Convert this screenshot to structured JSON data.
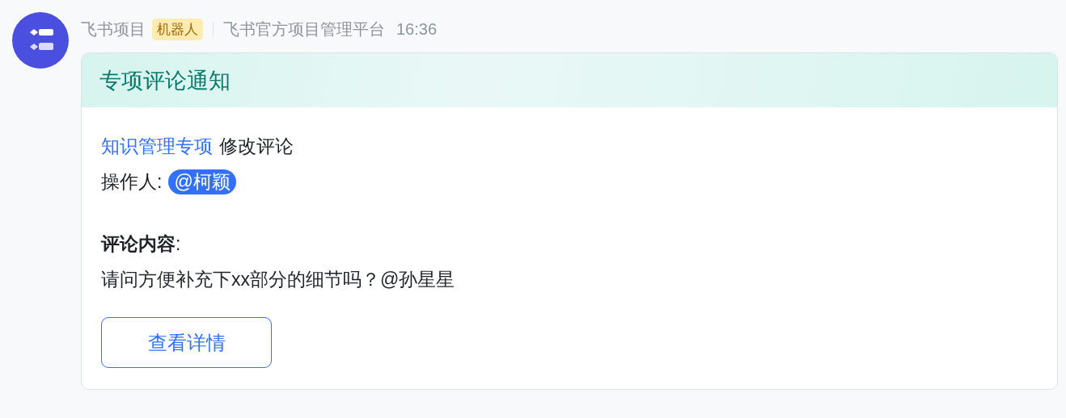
{
  "message": {
    "sender": "飞书项目",
    "badge": "机器人",
    "source": "飞书官方项目管理平台",
    "time": "16:36"
  },
  "card": {
    "title": "专项评论通知",
    "project_link": "知识管理专项",
    "action": "修改评论",
    "operator_label": "操作人:",
    "operator_mention": "@柯颖",
    "comment_label": "**评论内容**:",
    "comment_text": "请问方便补充下xx部分的细节吗？@孙星星",
    "button": "查看详情"
  }
}
